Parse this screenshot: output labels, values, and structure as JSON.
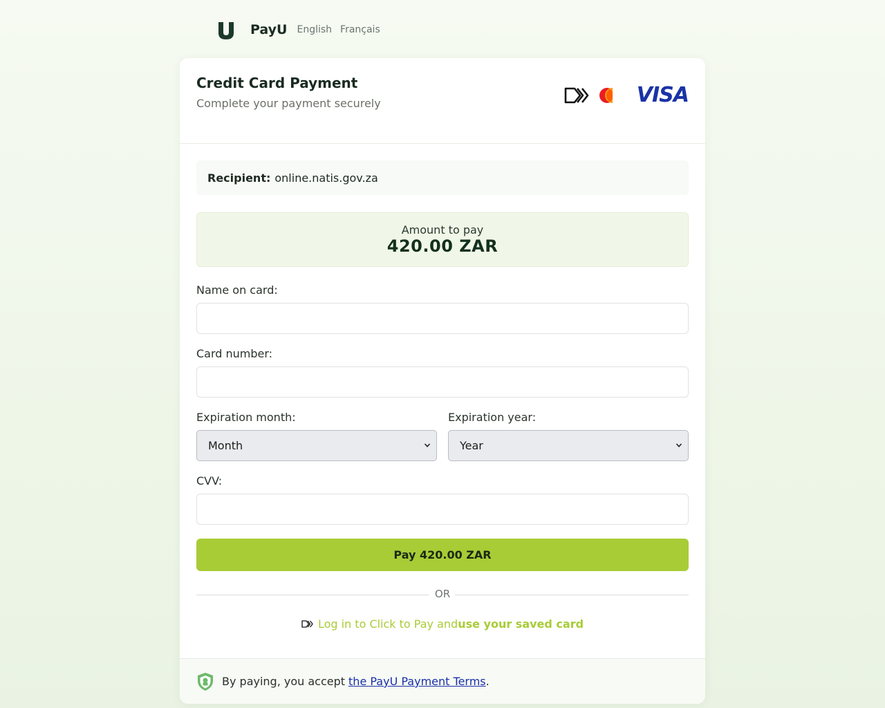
{
  "header": {
    "brand": "PayU",
    "logo_icon": "payu-u-logo-icon",
    "languages": [
      "English",
      "Français"
    ]
  },
  "card": {
    "title": "Credit Card Payment",
    "subtitle": "Complete your payment securely",
    "brand_icons": [
      "click-to-pay-icon",
      "mastercard-icon",
      "visa-logo"
    ],
    "visa_text": "VISA"
  },
  "recipient": {
    "label": "Recipient:",
    "value": "online.natis.gov.za"
  },
  "amount": {
    "label": "Amount to pay",
    "value": "420.00 ZAR"
  },
  "form": {
    "name_label": "Name on card:",
    "name_value": "",
    "card_label": "Card number:",
    "card_value": "",
    "exp_month_label": "Expiration month:",
    "exp_month_selected": "Month",
    "exp_year_label": "Expiration year:",
    "exp_year_selected": "Year",
    "cvv_label": "CVV:",
    "cvv_value": ""
  },
  "actions": {
    "pay_label": "Pay 420.00 ZAR",
    "or_text": "OR",
    "ctp_text": "Log in to Click to Pay and",
    "ctp_strong": "use your saved card"
  },
  "footer": {
    "text": "By paying, you accept",
    "link": "the PayU Payment Terms",
    "trail": "."
  },
  "colors": {
    "accent": "#a8cc36",
    "amount_bg": "#f1f7e8",
    "link": "#1a2fa8",
    "shield": "#6dba69"
  }
}
